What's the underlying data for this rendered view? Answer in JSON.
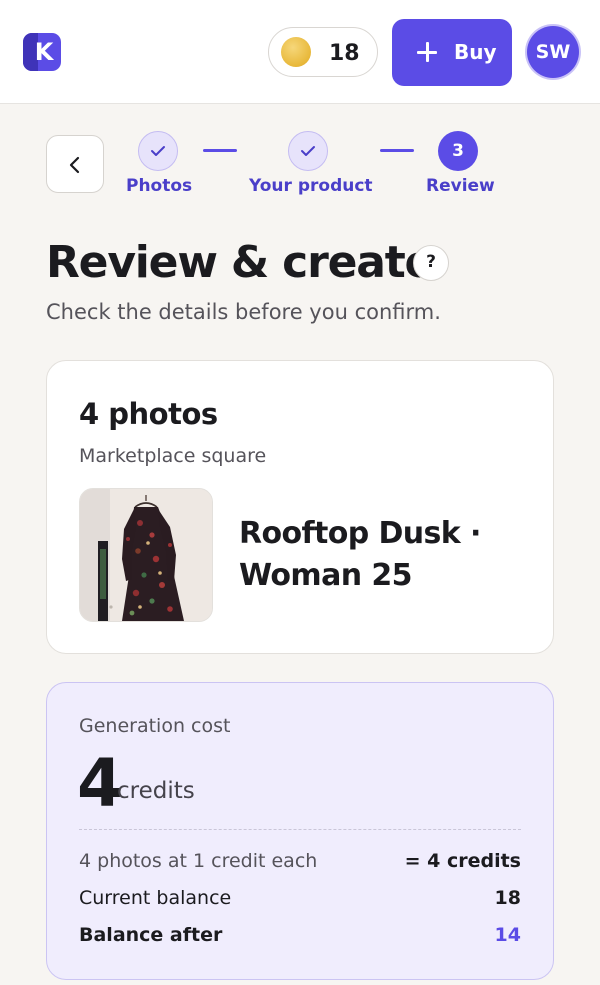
{
  "header": {
    "logo_letter": "K",
    "coin_balance": "18",
    "buy_label": "Buy",
    "avatar_initials": "SW"
  },
  "stepper": {
    "steps": [
      {
        "label": "Photos",
        "state": "done"
      },
      {
        "label": "Your product",
        "state": "done"
      },
      {
        "label": "Review",
        "state": "current",
        "number": "3"
      }
    ]
  },
  "page": {
    "title": "Review & create",
    "help": "?",
    "subtitle": "Check the details before you confirm."
  },
  "photos_card": {
    "count_label": "4 photos",
    "format": "Marketplace square",
    "product_name": "Rooftop Dusk · Woman 25"
  },
  "cost_card": {
    "label": "Generation cost",
    "amount": "4",
    "unit": "credits",
    "rows": [
      {
        "label": "4 photos at 1 credit each",
        "value": "= 4 credits"
      },
      {
        "label": "Current balance",
        "value": "18"
      },
      {
        "label": "Balance after",
        "value": "14"
      }
    ]
  },
  "colors": {
    "accent": "#5b4ce6",
    "background": "#f7f5f2",
    "cost_card_bg": "#f0edfd"
  }
}
